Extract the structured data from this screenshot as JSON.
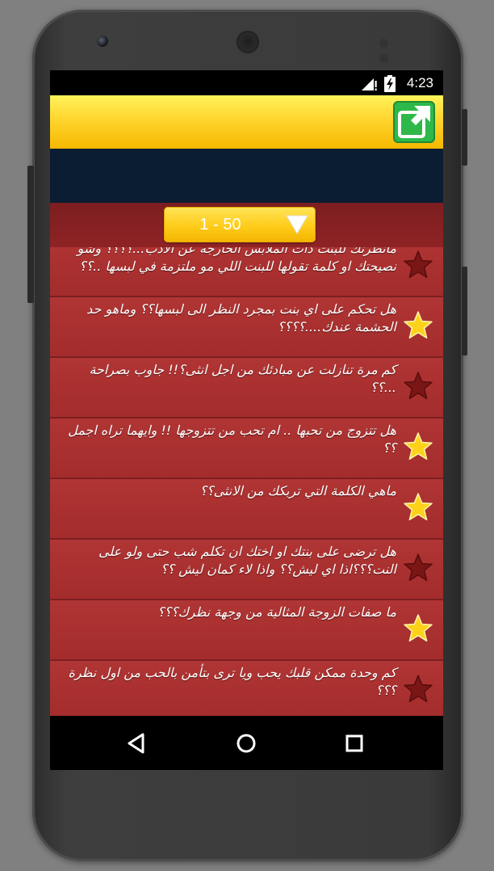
{
  "status": {
    "time": "4:23"
  },
  "icons": {
    "share": "share-icon",
    "signal": "signal-icon",
    "battery": "battery-icon",
    "star": "star-icon",
    "back": "back-icon",
    "home": "home-icon",
    "recents": "recents-icon"
  },
  "colors": {
    "appbar": "#ffd52e",
    "share_icon": "#2fb84a",
    "ad_banner": "#0b1d33",
    "list_bg": "#a83030",
    "star_active": "#ffd21a",
    "star_inactive": "#7a1616"
  },
  "range": {
    "label": "1 - 50"
  },
  "questions": [
    {
      "text": "مانظرتك للبنت ذات الملابس الخارجة عن الادب...؟؟؟؟ وشو نصيحتك او كلمة تقولها للبنت اللي مو ملتزمة في لبسها ..؟؟",
      "starred": false
    },
    {
      "text": "هل تحكم على اي بنت بمجرد النظر الى لبسها؟؟ وماهو حد الحشمة عندك....؟؟؟؟",
      "starred": true
    },
    {
      "text": "كم مرة تنازلت عن مبادئك من اجل انثى؟!! جاوب بصراحة ...؟؟",
      "starred": false
    },
    {
      "text": "هل تتزوج من تحبها .. ام تحب من تتزوجها !! وايهما تراه اجمل ؟؟",
      "starred": true
    },
    {
      "text": "ماهي الكلمة التي تربكك من الانثى؟؟",
      "starred": true
    },
    {
      "text": "هل ترضى على بنتك او اختك ان تكلم شب حتى ولو على النت؟؟؟اذا اي ليش؟؟ واذا لاء كمان ليش ؟؟",
      "starred": false
    },
    {
      "text": "ما صفات الزوجة المثالية من وجهة نظرك؟؟؟",
      "starred": true
    },
    {
      "text": "كم وحدة ممكن قلبك يحب ويا ترى بتأمن بالحب من اول نظرة ؟؟؟",
      "starred": false
    }
  ]
}
